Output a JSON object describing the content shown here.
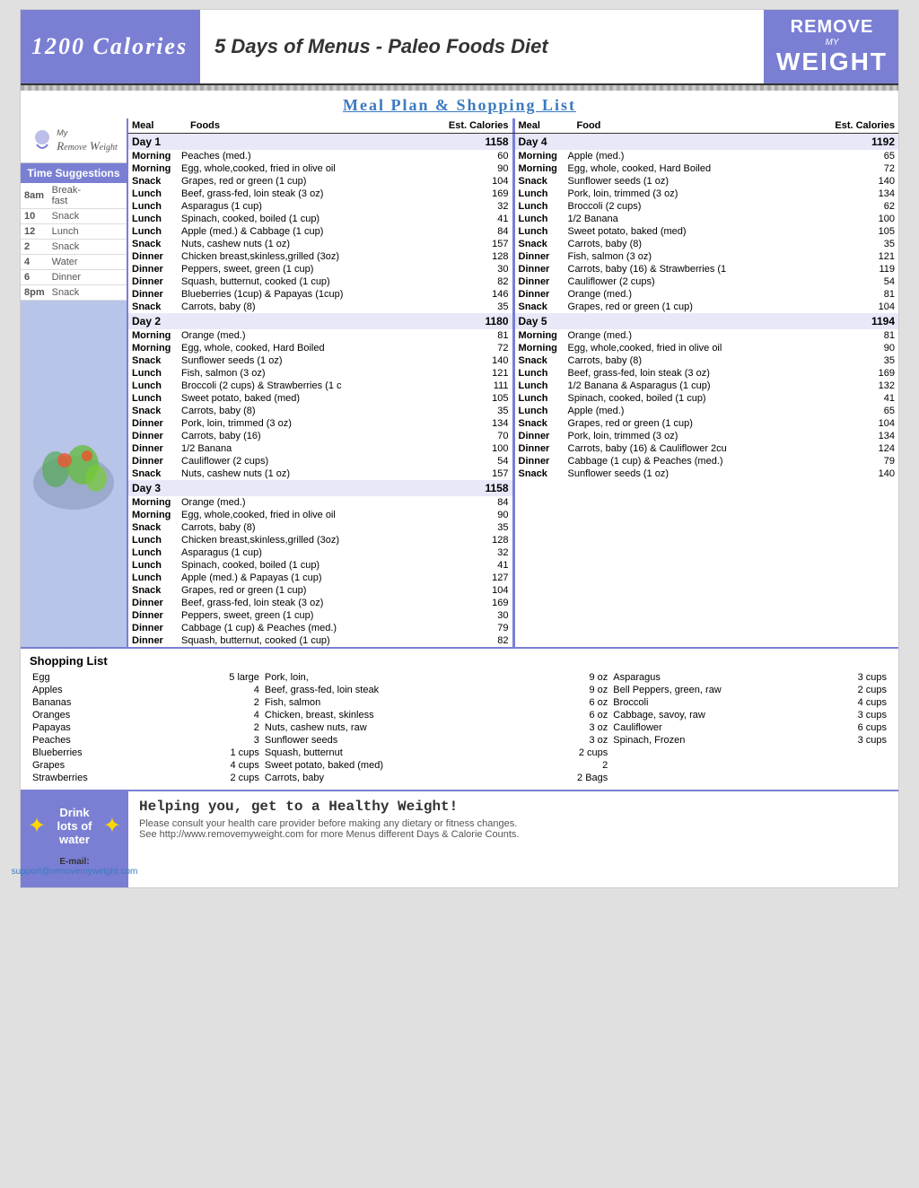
{
  "header": {
    "calories_title": "1200 Calories",
    "main_title": "5 Days of Menus - Paleo Foods Diet",
    "remove_line1": "REMOVE",
    "remove_my": "MY",
    "remove_weight": "WEIGHT"
  },
  "meal_plan_title": "Meal Plan & Shopping List",
  "table_headers": {
    "meal": "Meal",
    "foods": "Foods",
    "est_cal": "Est. Calories",
    "food": "Food"
  },
  "days": [
    {
      "day": "Day  1",
      "total": "1158",
      "rows": [
        {
          "meal": "Morning",
          "food": "Peaches (med.)",
          "cal": "60"
        },
        {
          "meal": "Morning",
          "food": "Egg, whole,cooked, fried in olive oil",
          "cal": "90"
        },
        {
          "meal": "Snack",
          "food": "Grapes, red or green  (1 cup)",
          "cal": "104"
        },
        {
          "meal": "Lunch",
          "food": "Beef, grass-fed, loin steak (3 oz)",
          "cal": "169"
        },
        {
          "meal": "Lunch",
          "food": "Asparagus (1 cup)",
          "cal": "32"
        },
        {
          "meal": "Lunch",
          "food": "Spinach, cooked, boiled (1 cup)",
          "cal": "41"
        },
        {
          "meal": "Lunch",
          "food": "Apple (med.) & Cabbage  (1 cup)",
          "cal": "84"
        },
        {
          "meal": "Snack",
          "food": "Nuts, cashew nuts (1 oz)",
          "cal": "157"
        },
        {
          "meal": "Dinner",
          "food": "Chicken breast,skinless,grilled (3oz)",
          "cal": "128"
        },
        {
          "meal": "Dinner",
          "food": "Peppers, sweet, green (1 cup)",
          "cal": "30"
        },
        {
          "meal": "Dinner",
          "food": "Squash, butternut, cooked (1 cup)",
          "cal": "82"
        },
        {
          "meal": "Dinner",
          "food": "Blueberries (1cup) & Papayas (1cup)",
          "cal": "146"
        },
        {
          "meal": "Snack",
          "food": "Carrots, baby  (8)",
          "cal": "35"
        }
      ]
    },
    {
      "day": "Day  2",
      "total": "1180",
      "rows": [
        {
          "meal": "Morning",
          "food": "Orange (med.)",
          "cal": "81"
        },
        {
          "meal": "Morning",
          "food": "Egg, whole, cooked, Hard Boiled",
          "cal": "72"
        },
        {
          "meal": "Snack",
          "food": "Sunflower seeds (1 oz)",
          "cal": "140"
        },
        {
          "meal": "Lunch",
          "food": "Fish, salmon (3 oz)",
          "cal": "121"
        },
        {
          "meal": "Lunch",
          "food": "Broccoli (2 cups) & Strawberries (1 c",
          "cal": "111"
        },
        {
          "meal": "Lunch",
          "food": "Sweet potato, baked (med)",
          "cal": "105"
        },
        {
          "meal": "Snack",
          "food": "Carrots, baby (8)",
          "cal": "35"
        },
        {
          "meal": "Dinner",
          "food": "Pork, loin, trimmed (3 oz)",
          "cal": "134"
        },
        {
          "meal": "Dinner",
          "food": "Carrots, baby (16)",
          "cal": "70"
        },
        {
          "meal": "Dinner",
          "food": "1/2 Banana",
          "cal": "100"
        },
        {
          "meal": "Dinner",
          "food": "Cauliflower (2 cups)",
          "cal": "54"
        },
        {
          "meal": "Snack",
          "food": "Nuts, cashew nuts (1 oz)",
          "cal": "157"
        }
      ]
    },
    {
      "day": "Day  3",
      "total": "1158",
      "rows": [
        {
          "meal": "Morning",
          "food": "Orange (med.)",
          "cal": "84"
        },
        {
          "meal": "Morning",
          "food": "Egg, whole,cooked, fried in olive oil",
          "cal": "90"
        },
        {
          "meal": "Snack",
          "food": "Carrots, baby (8)",
          "cal": "35"
        },
        {
          "meal": "Lunch",
          "food": "Chicken breast,skinless,grilled (3oz)",
          "cal": "128"
        },
        {
          "meal": "Lunch",
          "food": "Asparagus (1 cup)",
          "cal": "32"
        },
        {
          "meal": "Lunch",
          "food": "Spinach, cooked, boiled (1 cup)",
          "cal": "41"
        },
        {
          "meal": "Lunch",
          "food": "Apple (med.) & Papayas (1 cup)",
          "cal": "127"
        },
        {
          "meal": "Snack",
          "food": "Grapes, red or green  (1 cup)",
          "cal": "104"
        },
        {
          "meal": "Dinner",
          "food": "Beef, grass-fed, loin steak (3 oz)",
          "cal": "169"
        },
        {
          "meal": "Dinner",
          "food": "Peppers, sweet, green (1 cup)",
          "cal": "30"
        },
        {
          "meal": "Dinner",
          "food": "Cabbage  (1 cup) & Peaches (med.)",
          "cal": "79"
        },
        {
          "meal": "Dinner",
          "food": "Squash, butternut, cooked  (1 cup)",
          "cal": "82"
        }
      ]
    }
  ],
  "days_right": [
    {
      "day": "Day  4",
      "total": "1192",
      "rows": [
        {
          "meal": "Morning",
          "food": "Apple (med.)",
          "cal": "65"
        },
        {
          "meal": "Morning",
          "food": "Egg, whole, cooked, Hard Boiled",
          "cal": "72"
        },
        {
          "meal": "Snack",
          "food": "Sunflower seeds (1 oz)",
          "cal": "140"
        },
        {
          "meal": "Lunch",
          "food": "Pork, loin, trimmed (3 oz)",
          "cal": "134"
        },
        {
          "meal": "Lunch",
          "food": "Broccoli (2 cups)",
          "cal": "62"
        },
        {
          "meal": "Lunch",
          "food": "1/2 Banana",
          "cal": "100"
        },
        {
          "meal": "Lunch",
          "food": "Sweet potato, baked (med)",
          "cal": "105"
        },
        {
          "meal": "Snack",
          "food": "Carrots, baby  (8)",
          "cal": "35"
        },
        {
          "meal": "Dinner",
          "food": "Fish, salmon (3 oz)",
          "cal": "121"
        },
        {
          "meal": "Dinner",
          "food": "Carrots, baby (16) & Strawberries (1",
          "cal": "119"
        },
        {
          "meal": "Dinner",
          "food": "Cauliflower (2 cups)",
          "cal": "54"
        },
        {
          "meal": "Dinner",
          "food": "Orange (med.)",
          "cal": "81"
        },
        {
          "meal": "Snack",
          "food": "Grapes, red or green  (1 cup)",
          "cal": "104"
        }
      ]
    },
    {
      "day": "Day  5",
      "total": "1194",
      "rows": [
        {
          "meal": "Morning",
          "food": "Orange (med.)",
          "cal": "81"
        },
        {
          "meal": "Morning",
          "food": "Egg, whole,cooked, fried in olive oil",
          "cal": "90"
        },
        {
          "meal": "Snack",
          "food": "Carrots, baby (8)",
          "cal": "35"
        },
        {
          "meal": "Lunch",
          "food": "Beef, grass-fed, loin steak (3 oz)",
          "cal": "169"
        },
        {
          "meal": "Lunch",
          "food": "1/2 Banana & Asparagus (1 cup)",
          "cal": "132"
        },
        {
          "meal": "Lunch",
          "food": "Spinach, cooked, boiled  (1 cup)",
          "cal": "41"
        },
        {
          "meal": "Lunch",
          "food": "Apple (med.)",
          "cal": "65"
        },
        {
          "meal": "Snack",
          "food": "Grapes, red or green  (1 cup)",
          "cal": "104"
        },
        {
          "meal": "Dinner",
          "food": "Pork, loin, trimmed (3 oz)",
          "cal": "134"
        },
        {
          "meal": "Dinner",
          "food": "Carrots, baby (16) & Cauliflower 2cu",
          "cal": "124"
        },
        {
          "meal": "Dinner",
          "food": "Cabbage  (1 cup) & Peaches (med.)",
          "cal": "79"
        },
        {
          "meal": "Snack",
          "food": "Sunflower seeds (1 oz)",
          "cal": "140"
        }
      ]
    }
  ],
  "time_suggestions": {
    "title": "Time Suggestions",
    "rows": [
      {
        "time": "8am",
        "meal": "Break-\nfast"
      },
      {
        "time": "10",
        "meal": "Snack"
      },
      {
        "time": "12",
        "meal": "Lunch"
      },
      {
        "time": "2",
        "meal": "Snack"
      },
      {
        "time": "4",
        "meal": "Water"
      },
      {
        "time": "6",
        "meal": "Dinner"
      },
      {
        "time": "8pm",
        "meal": "Snack"
      }
    ]
  },
  "shopping": {
    "title": "Shopping List",
    "col1": [
      {
        "item": "Egg",
        "qty": "5 large"
      },
      {
        "item": "Apples",
        "qty": "4"
      },
      {
        "item": "Bananas",
        "qty": "2"
      },
      {
        "item": "Oranges",
        "qty": "4"
      },
      {
        "item": "Papayas",
        "qty": "2"
      },
      {
        "item": "Peaches",
        "qty": "3"
      },
      {
        "item": "Blueberries",
        "qty": "1 cups"
      },
      {
        "item": "Grapes",
        "qty": "4 cups"
      },
      {
        "item": "Strawberries",
        "qty": "2 cups"
      }
    ],
    "col2": [
      {
        "item": "Pork, loin,",
        "qty": "9 oz"
      },
      {
        "item": "Beef, grass-fed, loin steak",
        "qty": "9 oz"
      },
      {
        "item": "Fish, salmon",
        "qty": "6 oz"
      },
      {
        "item": "Chicken, breast, skinless",
        "qty": "6 oz"
      },
      {
        "item": "Nuts, cashew nuts, raw",
        "qty": "3 oz"
      },
      {
        "item": "Sunflower seeds",
        "qty": "3 oz"
      },
      {
        "item": "Squash, butternut",
        "qty": "2 cups"
      },
      {
        "item": "Sweet potato, baked (med)",
        "qty": "2"
      },
      {
        "item": "Carrots, baby",
        "qty": "2 Bags"
      }
    ],
    "col3": [
      {
        "item": "Asparagus",
        "qty": "3 cups"
      },
      {
        "item": "Bell Peppers, green, raw",
        "qty": "2 cups"
      },
      {
        "item": "Broccoli",
        "qty": "4 cups"
      },
      {
        "item": "Cabbage, savoy, raw",
        "qty": "3 cups"
      },
      {
        "item": "Cauliflower",
        "qty": "6 cups"
      },
      {
        "item": "Spinach, Frozen",
        "qty": "3 cups"
      }
    ]
  },
  "bottom": {
    "drink_text": "Drink lots of water",
    "email_label": "E-mail:",
    "email": "support@removemyweight.com",
    "helping_text": "Helping you, get to a Healthy Weight!",
    "disclaimer1": "Please consult your health care provider before making any dietary or fitness changes.",
    "disclaimer2": "See http://www.removemyweight.com for more Menus different Days & Calorie Counts."
  }
}
